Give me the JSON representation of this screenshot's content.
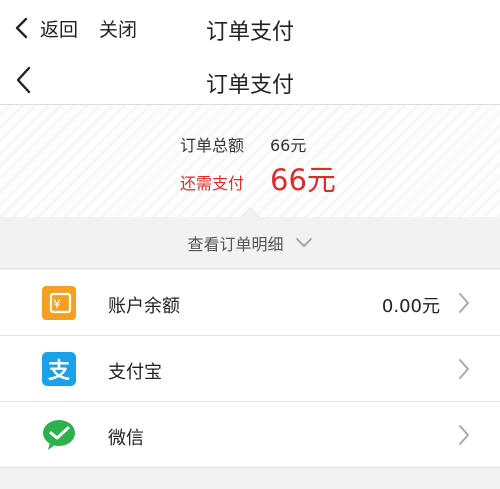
{
  "topbar": {
    "back_label": "返回",
    "close_label": "关闭",
    "title": "订单支付"
  },
  "pagebar": {
    "title": "订单支付"
  },
  "summary": {
    "total_label": "订单总额",
    "total_value": "66元",
    "due_label": "还需支付",
    "due_value": "66元",
    "due_color": "#e02b2b"
  },
  "detail_toggle": {
    "label": "查看订单明细",
    "icon": "chevron-down-icon"
  },
  "payment_methods": [
    {
      "name": "账户余额",
      "value": "0.00元",
      "icon": "wallet-icon",
      "color": "#f5a020"
    },
    {
      "name": "支付宝",
      "value": "",
      "icon": "alipay-icon",
      "color": "#1ba1e6"
    },
    {
      "name": "微信",
      "value": "",
      "icon": "wechat-pay-icon",
      "color": "#2bb24c"
    }
  ]
}
